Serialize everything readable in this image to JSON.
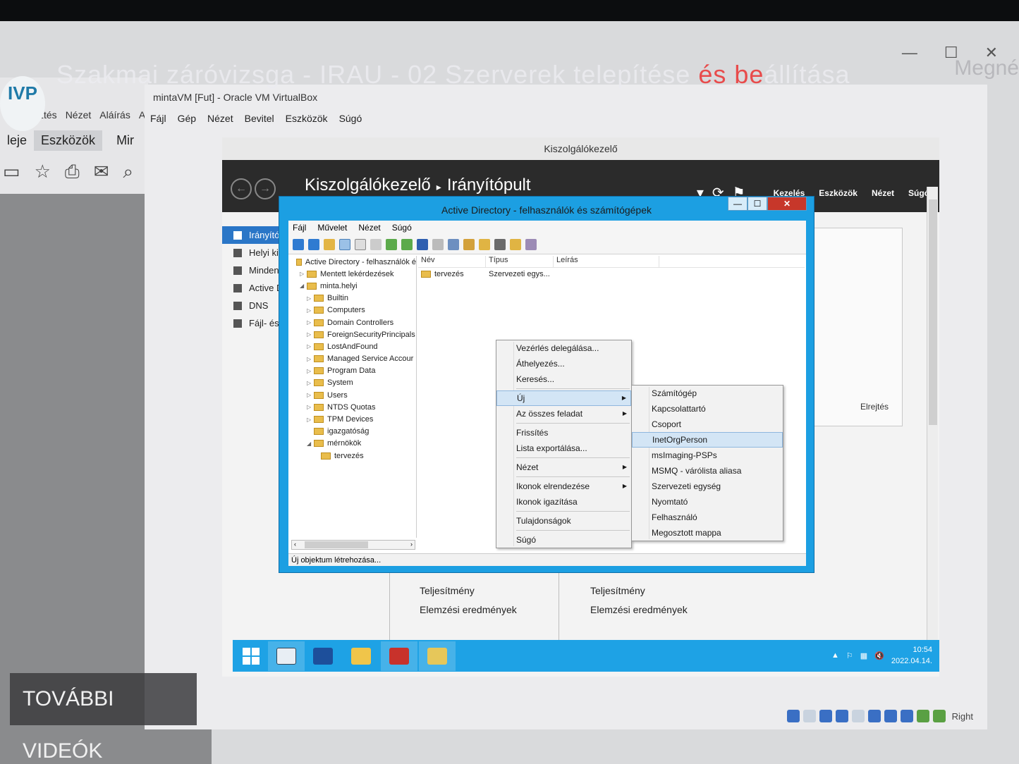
{
  "overlay": {
    "video_title_part1": "Szakmai záróvizsga - IRAU - 02 Szerverek telepítése ",
    "video_title_highlight": "és be",
    "video_title_part2": "állítása",
    "side_text": "Megné",
    "more_videos": "TOVÁBBI VIDEÓK"
  },
  "pdf_app": {
    "menu": [
      "ztés",
      "Nézet",
      "Aláírás",
      "Ab"
    ],
    "tabs": [
      "leje",
      "Eszközök",
      "Mir"
    ],
    "tools": [
      "save-icon",
      "star-icon",
      "print-icon",
      "mail-icon",
      "zoom-icon"
    ]
  },
  "vbox": {
    "title": "mintaVM [Fut] - Oracle VM VirtualBox",
    "menu": [
      "Fájl",
      "Gép",
      "Nézet",
      "Bevitel",
      "Eszközök",
      "Súgó"
    ],
    "status_right": "Right"
  },
  "server_manager": {
    "title": "Kiszolgálókezelő",
    "breadcrumb_root": "Kiszolgálókezelő",
    "breadcrumb_page": "Irányítópult",
    "menu": [
      "Kezelés",
      "Eszközök",
      "Nézet",
      "Súgó"
    ],
    "sidebar": [
      "Irányító",
      "Helyi ki",
      "Minden",
      "Active D",
      "DNS",
      "Fájl- és"
    ],
    "hide_label": "Elrejtés",
    "tiles": [
      {
        "row1": "Teljesítmény",
        "row2": "Elemzési eredmények"
      },
      {
        "row1": "Teljesítmény",
        "row2": "Elemzési eredmények"
      }
    ]
  },
  "taskbar": {
    "time": "10:54",
    "date": "2022.04.14."
  },
  "ad": {
    "title": "Active Directory - felhasználók és számítógépek",
    "menu": [
      "Fájl",
      "Művelet",
      "Nézet",
      "Súgó"
    ],
    "tree": [
      {
        "label": "Active Directory - felhasználók é",
        "level": 0,
        "arrow": ""
      },
      {
        "label": "Mentett lekérdezések",
        "level": 1,
        "arrow": "▷"
      },
      {
        "label": "minta.helyi",
        "level": 1,
        "arrow": "◢"
      },
      {
        "label": "Builtin",
        "level": 2,
        "arrow": "▷"
      },
      {
        "label": "Computers",
        "level": 2,
        "arrow": "▷"
      },
      {
        "label": "Domain Controllers",
        "level": 2,
        "arrow": "▷"
      },
      {
        "label": "ForeignSecurityPrincipals",
        "level": 2,
        "arrow": "▷"
      },
      {
        "label": "LostAndFound",
        "level": 2,
        "arrow": "▷"
      },
      {
        "label": "Managed Service Accour",
        "level": 2,
        "arrow": "▷"
      },
      {
        "label": "Program Data",
        "level": 2,
        "arrow": "▷"
      },
      {
        "label": "System",
        "level": 2,
        "arrow": "▷"
      },
      {
        "label": "Users",
        "level": 2,
        "arrow": "▷"
      },
      {
        "label": "NTDS Quotas",
        "level": 2,
        "arrow": "▷"
      },
      {
        "label": "TPM Devices",
        "level": 2,
        "arrow": "▷"
      },
      {
        "label": "igazgatóság",
        "level": 2,
        "arrow": ""
      },
      {
        "label": "mérnökök",
        "level": 2,
        "arrow": "◢"
      },
      {
        "label": "tervezés",
        "level": 3,
        "arrow": ""
      }
    ],
    "columns": [
      "Név",
      "Típus",
      "Leírás"
    ],
    "rows": [
      {
        "name": "tervezés",
        "type": "Szervezeti egys..."
      }
    ],
    "status": "Új objektum létrehozása..."
  },
  "context_menu": {
    "items": [
      {
        "label": "Vezérlés delegálása...",
        "sub": false,
        "sep_after": false
      },
      {
        "label": "Áthelyezés...",
        "sub": false,
        "sep_after": false
      },
      {
        "label": "Keresés...",
        "sub": false,
        "sep_after": true
      },
      {
        "label": "Új",
        "sub": true,
        "sep_after": false,
        "hl": true
      },
      {
        "label": "Az összes feladat",
        "sub": true,
        "sep_after": true
      },
      {
        "label": "Frissítés",
        "sub": false,
        "sep_after": false
      },
      {
        "label": "Lista exportálása...",
        "sub": false,
        "sep_after": true
      },
      {
        "label": "Nézet",
        "sub": true,
        "sep_after": true
      },
      {
        "label": "Ikonok elrendezése",
        "sub": true,
        "sep_after": false
      },
      {
        "label": "Ikonok igazítása",
        "sub": false,
        "sep_after": true
      },
      {
        "label": "Tulajdonságok",
        "sub": false,
        "sep_after": true
      },
      {
        "label": "Súgó",
        "sub": false,
        "sep_after": false
      }
    ]
  },
  "submenu": {
    "items": [
      {
        "label": "Számítógép",
        "sep_after": false
      },
      {
        "label": "Kapcsolattartó",
        "sep_after": false
      },
      {
        "label": "Csoport",
        "sep_after": false
      },
      {
        "label": "InetOrgPerson",
        "sep_after": false,
        "hl": true
      },
      {
        "label": "msImaging-PSPs",
        "sep_after": false
      },
      {
        "label": "MSMQ - várólista aliasa",
        "sep_after": false
      },
      {
        "label": "Szervezeti egység",
        "sep_after": false
      },
      {
        "label": "Nyomtató",
        "sep_after": false
      },
      {
        "label": "Felhasználó",
        "sep_after": false
      },
      {
        "label": "Megosztott mappa",
        "sep_after": false
      }
    ]
  }
}
